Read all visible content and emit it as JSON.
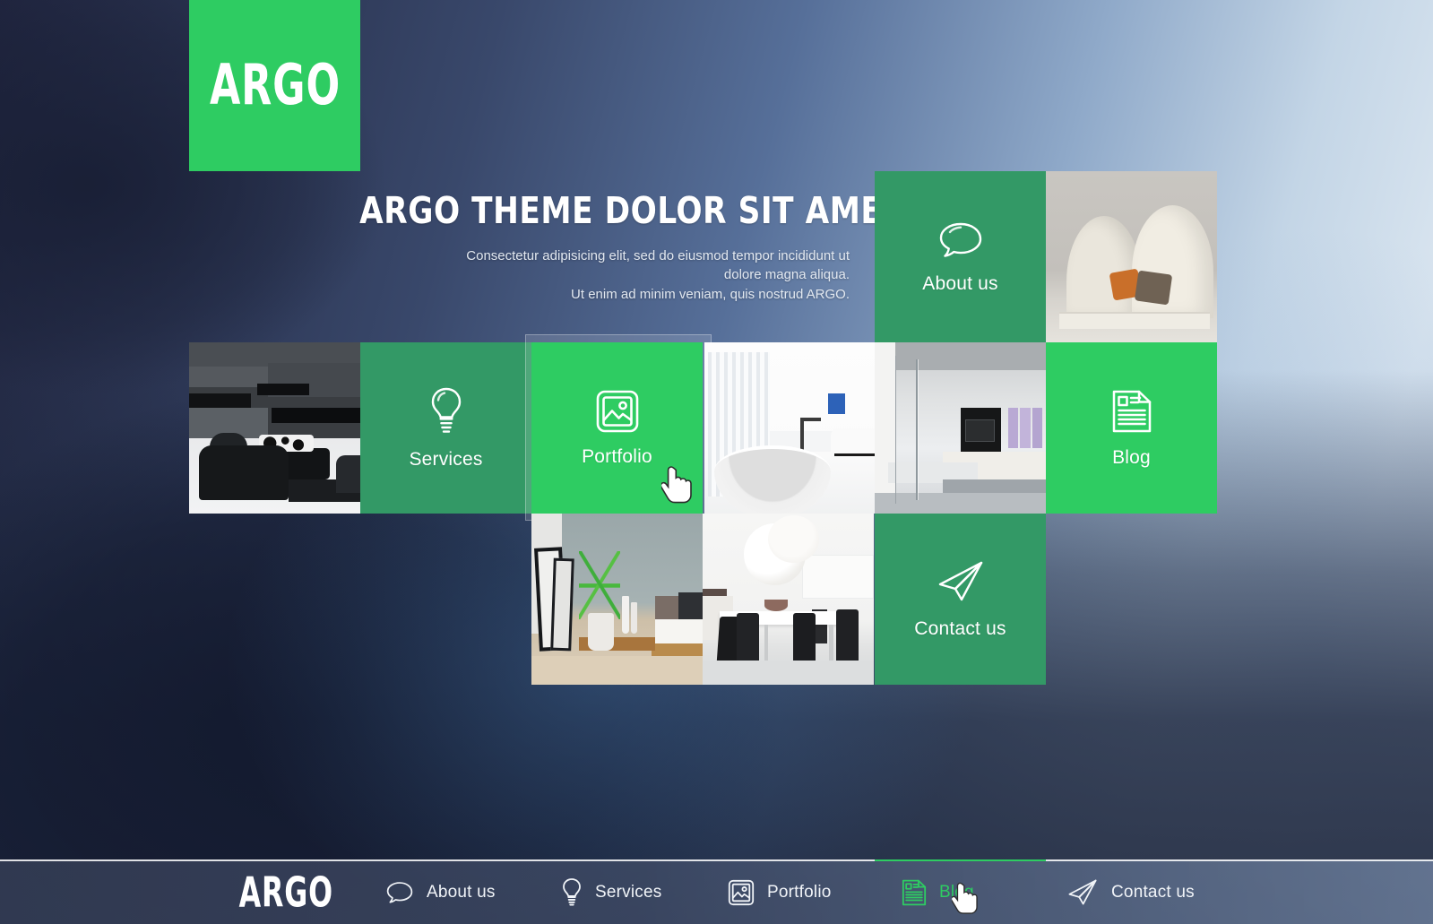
{
  "brand": {
    "name": "ARGO"
  },
  "hero": {
    "title": "ARGO THEME DOLOR SIT AMET ELASDE",
    "subtitle_line1": "Consectetur adipisicing elit, sed do eiusmod tempor incididunt ut",
    "subtitle_line2": "dolore magna aliqua.",
    "subtitle_line3": "Ut enim ad minim veniam, quis nostrud ARGO."
  },
  "colors": {
    "green_bright": "#2ecc62",
    "green_muted": "#339966",
    "text_light": "#ffffff",
    "nav_active": "#2ecc62"
  },
  "tiles": [
    {
      "key": "logo",
      "label": "ARGO",
      "type": "logo",
      "icon": "none",
      "state": "default"
    },
    {
      "key": "about",
      "label": "About us",
      "type": "menu",
      "icon": "speech-bubble-icon",
      "state": "default"
    },
    {
      "key": "services",
      "label": "Services",
      "type": "menu",
      "icon": "lightbulb-icon",
      "state": "default"
    },
    {
      "key": "portfolio",
      "label": "Portfolio",
      "type": "menu",
      "icon": "image-icon",
      "state": "hover"
    },
    {
      "key": "blog",
      "label": "Blog",
      "type": "menu",
      "icon": "article-icon",
      "state": "highlight"
    },
    {
      "key": "contact",
      "label": "Contact us",
      "type": "menu",
      "icon": "paper-plane-icon",
      "state": "default"
    }
  ],
  "photos": [
    {
      "key": "dark-living-room",
      "alt": "Dark modern living room with black sofa"
    },
    {
      "key": "cream-curved-sofa",
      "alt": "Cream curved sofa with orange and brown pillows"
    },
    {
      "key": "white-bathroom",
      "alt": "White bathroom with round freestanding bathtub"
    },
    {
      "key": "glass-interior",
      "alt": "Modern interior with glass partition and purple panels"
    },
    {
      "key": "bedroom-plant",
      "alt": "Bedroom with green potted plant and framed art"
    },
    {
      "key": "dining-room",
      "alt": "White dining room with black chairs and pendant lamp"
    }
  ],
  "bottom_nav": {
    "logo": "ARGO",
    "items": [
      {
        "label": "About us",
        "icon": "speech-bubble-icon",
        "active": false
      },
      {
        "label": "Services",
        "icon": "lightbulb-icon",
        "active": false
      },
      {
        "label": "Portfolio",
        "icon": "image-icon",
        "active": false
      },
      {
        "label": "Blog",
        "icon": "article-icon",
        "active": true
      },
      {
        "label": "Contact us",
        "icon": "paper-plane-icon",
        "active": false
      }
    ]
  }
}
